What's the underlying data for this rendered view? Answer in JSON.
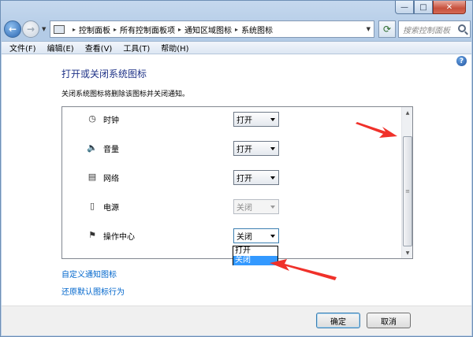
{
  "window": {
    "caption": {
      "minimize_glyph": "—",
      "maximize_glyph": "□",
      "close_glyph": "✕"
    }
  },
  "nav": {
    "back_glyph": "←",
    "forward_glyph": "→",
    "breadcrumbs": [
      "控制面板",
      "所有控制面板项",
      "通知区域图标",
      "系统图标"
    ],
    "refresh_glyph": "⟳",
    "search_placeholder": "搜索控制面板"
  },
  "menu": [
    "文件(F)",
    "编辑(E)",
    "查看(V)",
    "工具(T)",
    "帮助(H)"
  ],
  "content": {
    "help_glyph": "?",
    "title": "打开或关闭系统图标",
    "description": "关闭系统图标将删除该图标并关闭通知。",
    "rows": [
      {
        "label": "时钟",
        "icon": "clock-icon",
        "glyph": "◷",
        "value": "打开",
        "disabled": false
      },
      {
        "label": "音量",
        "icon": "speaker-icon",
        "glyph": "🔈",
        "value": "打开",
        "disabled": false
      },
      {
        "label": "网络",
        "icon": "network-icon",
        "glyph": "▤",
        "value": "打开",
        "disabled": false
      },
      {
        "label": "电源",
        "icon": "power-icon",
        "glyph": "▯",
        "value": "关闭",
        "disabled": true
      },
      {
        "label": "操作中心",
        "icon": "flag-icon",
        "glyph": "⚑",
        "value": "关闭",
        "disabled": false
      }
    ],
    "dropdown_options": [
      "打开",
      "关闭"
    ],
    "dropdown_selected": "关闭",
    "links": [
      "自定义通知图标",
      "还原默认图标行为"
    ]
  },
  "buttons": {
    "ok": "确定",
    "cancel": "取消"
  },
  "colors": {
    "annotation_red": "#f0312a",
    "title_blue": "#1e3287",
    "link_blue": "#0066cc",
    "selection_blue": "#3399ff"
  }
}
